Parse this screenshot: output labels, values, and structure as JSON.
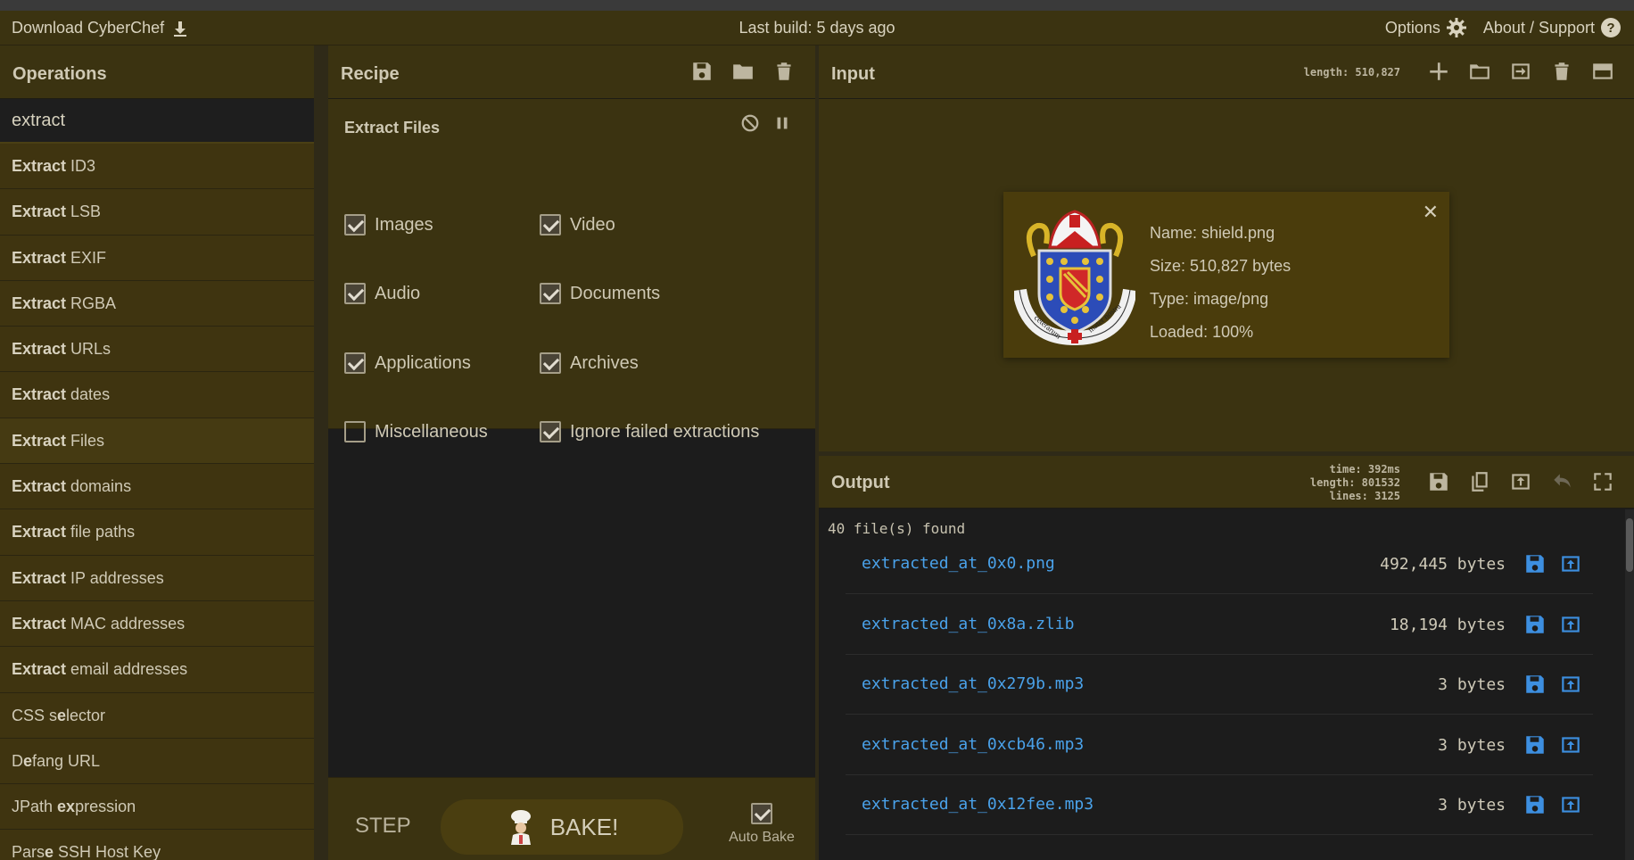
{
  "banner": {
    "download_label": "Download CyberChef",
    "build_info": "Last build: 5 days ago",
    "options_label": "Options",
    "about_label": "About / Support"
  },
  "operations": {
    "title": "Operations",
    "search_value": "extract",
    "items": [
      {
        "bold": "Extract",
        "rest": " ID3"
      },
      {
        "bold": "Extract",
        "rest": " LSB"
      },
      {
        "bold": "Extract",
        "rest": " EXIF"
      },
      {
        "bold": "Extract",
        "rest": " RGBA"
      },
      {
        "bold": "Extract",
        "rest": " URLs"
      },
      {
        "bold": "Extract",
        "rest": " dates"
      },
      {
        "bold": "Extract",
        "rest": " Files"
      },
      {
        "bold": "Extract",
        "rest": " domains"
      },
      {
        "bold": "Extract",
        "rest": " file paths"
      },
      {
        "bold": "Extract",
        "rest": " IP addresses"
      },
      {
        "bold": "Extract",
        "rest": " MAC addresses"
      },
      {
        "bold": "Extract",
        "rest": " email addresses"
      },
      {
        "pre": "CSS s",
        "bold": "e",
        "rest": "lector"
      },
      {
        "pre": "D",
        "bold": "e",
        "rest": "fang URL"
      },
      {
        "pre": "JPath ",
        "bold": "ex",
        "rest": "pression"
      },
      {
        "pre": "Pars",
        "bold": "e",
        "rest": " SSH Host Key"
      }
    ]
  },
  "recipe": {
    "title": "Recipe",
    "op_name": "Extract Files",
    "options": {
      "images": "Images",
      "video": "Video",
      "audio": "Audio",
      "documents": "Documents",
      "applications": "Applications",
      "archives": "Archives",
      "misc": "Miscellaneous",
      "ignore_failed": "Ignore failed extractions"
    },
    "step_label": "STEP",
    "bake_label": "BAKE!",
    "auto_bake_label": "Auto Bake"
  },
  "input": {
    "title": "Input",
    "length": "length: 510,827",
    "file": {
      "name": "Name: shield.png",
      "size": "Size: 510,827 bytes",
      "type": "Type: image/png",
      "loaded": "Loaded: 100%",
      "motto_left": "ceterarum",
      "motto_right": "mater nostra"
    }
  },
  "output": {
    "title": "Output",
    "time": "time:  392ms",
    "length": "length: 801532",
    "lines": "lines:   3125",
    "found_text": "40 file(s) found",
    "files": [
      {
        "name": "extracted_at_0x0.png",
        "size": "492,445 bytes"
      },
      {
        "name": "extracted_at_0x8a.zlib",
        "size": "18,194 bytes"
      },
      {
        "name": "extracted_at_0x279b.mp3",
        "size": "3 bytes"
      },
      {
        "name": "extracted_at_0xcb46.mp3",
        "size": "3 bytes"
      },
      {
        "name": "extracted_at_0x12fee.mp3",
        "size": "3 bytes"
      }
    ]
  },
  "colors": {
    "accent": "#3b3311",
    "link": "#4aa2ea"
  }
}
